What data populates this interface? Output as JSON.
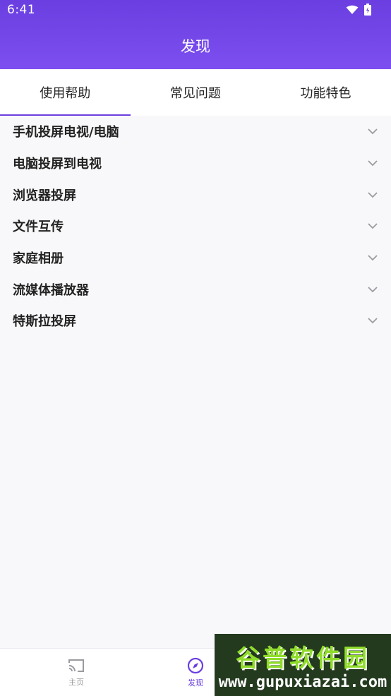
{
  "status_bar": {
    "time": "6:41"
  },
  "app_bar": {
    "title": "发现"
  },
  "tabs": [
    {
      "label": "使用帮助",
      "active": true
    },
    {
      "label": "常见问题",
      "active": false
    },
    {
      "label": "功能特色",
      "active": false
    }
  ],
  "help_items": [
    {
      "label": "手机投屏电视/电脑"
    },
    {
      "label": "电脑投屏到电视"
    },
    {
      "label": "浏览器投屏"
    },
    {
      "label": "文件互传"
    },
    {
      "label": "家庭相册"
    },
    {
      "label": "流媒体播放器"
    },
    {
      "label": "特斯拉投屏"
    }
  ],
  "bottom_nav": {
    "home_label": "主页",
    "discover_label": "发现"
  },
  "watermark": {
    "brand": "谷普软件园",
    "url": "www.gupuxiazai.com"
  },
  "colors": {
    "accent": "#6a3ee0",
    "watermark_green": "#8fdc2a"
  }
}
